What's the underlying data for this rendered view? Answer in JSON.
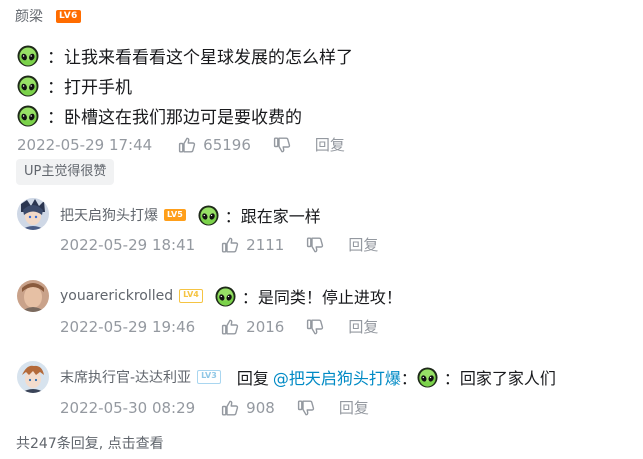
{
  "comment": {
    "username": "颜梁",
    "level": "LV6",
    "lines": [
      "：让我来看看看这个星球发展的怎么样了",
      "：打开手机",
      "：卧槽这在我们那边可是要收费的"
    ],
    "time": "2022-05-29 17:44",
    "likes": "65196",
    "reply_label": "回复",
    "up_tag": "UP主觉得很赞"
  },
  "replies": [
    {
      "username": "把天启狗头打爆",
      "level": "LV5",
      "text": "：跟在家一样",
      "time": "2022-05-29 18:41",
      "likes": "2111",
      "reply_label": "回复"
    },
    {
      "username": "youarerickrolled",
      "level": "LV4",
      "text": "：是同类！停止进攻！",
      "time": "2022-05-29 19:46",
      "likes": "2016",
      "reply_label": "回复"
    },
    {
      "username": "末席执行官-达达利亚",
      "level": "LV3",
      "prefix": "回复",
      "mention": "@把天启狗头打爆",
      "mention_suffix": "：",
      "text": "：回家了家人们",
      "time": "2022-05-30 08:29",
      "likes": "908",
      "reply_label": "回复"
    }
  ],
  "footer": {
    "more_text": "共247条回复, 点击查看"
  },
  "colors": {
    "lv6": "#ff6c00",
    "lv5": "#ff9f1a",
    "lv4": "#f5c443",
    "lv3": "#a9d6f0",
    "mention": "#008ac5",
    "meta": "#9499a0"
  }
}
